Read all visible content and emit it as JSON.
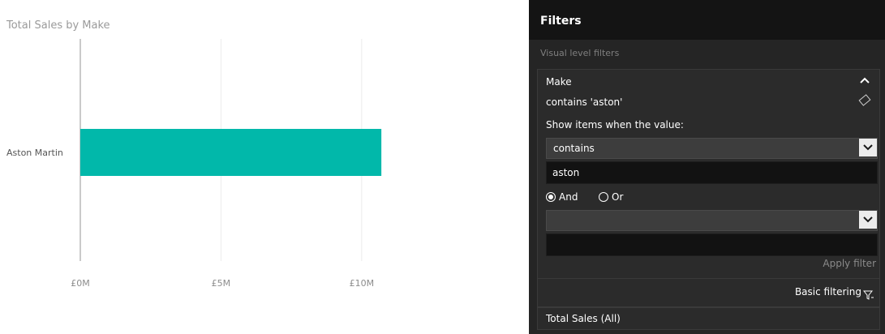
{
  "chart_data": {
    "type": "bar",
    "orientation": "horizontal",
    "title": "Total Sales by Make",
    "categories": [
      "Aston Martin"
    ],
    "values": [
      10.7
    ],
    "value_unit": "£M",
    "xlim": [
      0,
      11.1
    ],
    "xticks": [
      0,
      5,
      10
    ],
    "xtick_labels": [
      "£0M",
      "£5M",
      "£10M"
    ],
    "grid": true,
    "bar_color": "#01b8aa"
  },
  "filters": {
    "title": "Filters",
    "subtitle": "Visual level filters",
    "make_card": {
      "title": "Make",
      "summary": "contains 'aston'",
      "instruction": "Show items when the value:",
      "condition1_value": "contains",
      "text1_value": "aston",
      "and_label": "And",
      "or_label": "Or",
      "selected_logic": "And",
      "condition2_value": "",
      "text2_value": "",
      "apply_label": "Apply filter",
      "basic_filtering_label": "Basic filtering"
    },
    "sales_card": {
      "title": "Total Sales (All)"
    }
  }
}
